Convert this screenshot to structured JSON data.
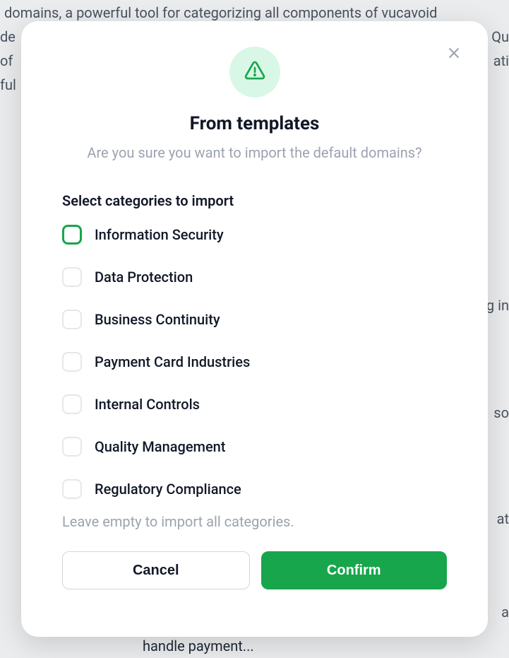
{
  "background": {
    "line1": "domains, a powerful tool for categorizing all components of vucavoid",
    "line2_left": "de",
    "line2_right": "Qu",
    "line3_left": "of",
    "line3_right": "ati",
    "line4_left": "ful",
    "line5_right": "g in",
    "line6_right": "so",
    "line7_right": "at",
    "line8_right": "a",
    "line9": "handle payment..."
  },
  "modal": {
    "icon": "warning-icon",
    "title": "From templates",
    "subtitle": "Are you sure you want to import the default domains?",
    "section_label": "Select categories to import",
    "categories": [
      {
        "label": "Information Security",
        "focused": true
      },
      {
        "label": "Data Protection",
        "focused": false
      },
      {
        "label": "Business Continuity",
        "focused": false
      },
      {
        "label": "Payment Card Industries",
        "focused": false
      },
      {
        "label": "Internal Controls",
        "focused": false
      },
      {
        "label": "Quality Management",
        "focused": false
      },
      {
        "label": "Regulatory Compliance",
        "focused": false
      }
    ],
    "hint": "Leave empty to import all categories.",
    "cancel_label": "Cancel",
    "confirm_label": "Confirm"
  },
  "colors": {
    "accent": "#17a64b",
    "muted": "#9ca3af",
    "border": "#e5e7eb"
  }
}
